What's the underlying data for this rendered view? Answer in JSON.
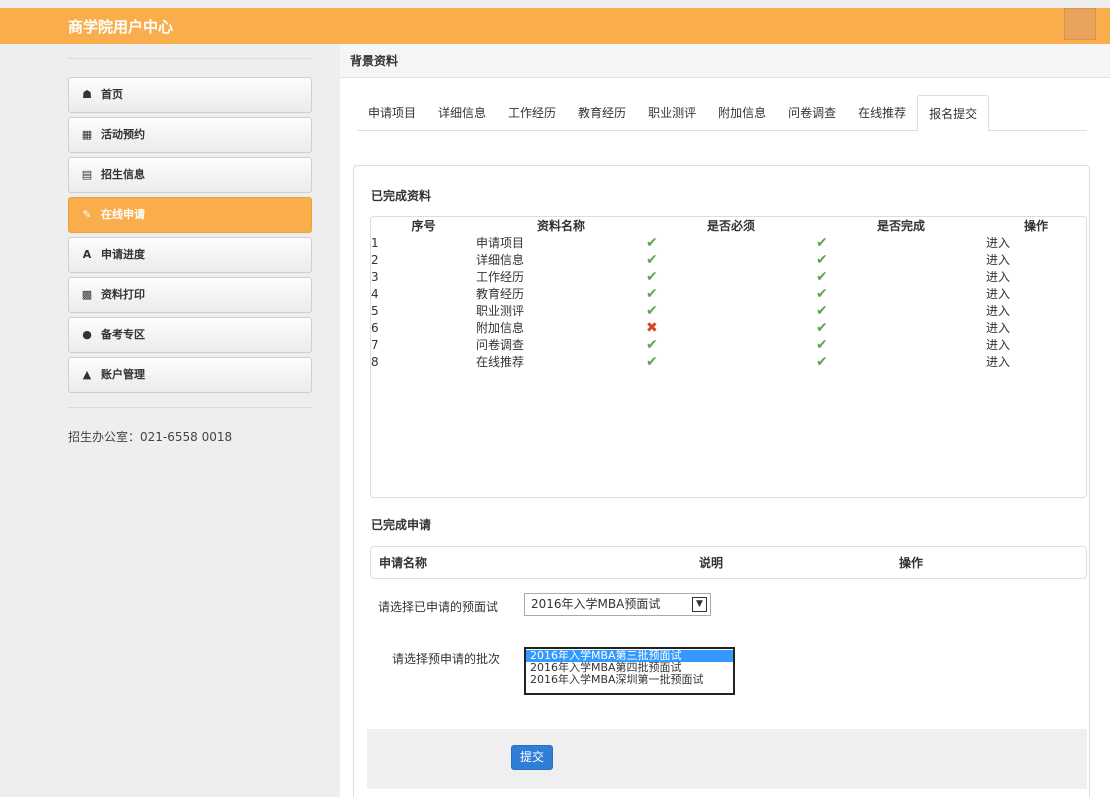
{
  "header": {
    "title": "商学院用户中心"
  },
  "sidebar": {
    "items": [
      {
        "label": "首页",
        "icon": "home-icon"
      },
      {
        "label": "活动预约",
        "icon": "calendar-icon"
      },
      {
        "label": "招生信息",
        "icon": "book-icon"
      },
      {
        "label": "在线申请",
        "icon": "edit-icon",
        "active": true
      },
      {
        "label": "申请进度",
        "icon": "font-icon"
      },
      {
        "label": "资料打印",
        "icon": "print-icon"
      },
      {
        "label": "备考专区",
        "icon": "lock-icon"
      },
      {
        "label": "账户管理",
        "icon": "user-icon"
      }
    ],
    "contact": "招生办公室：021-6558 0018"
  },
  "main": {
    "heading": "背景资料",
    "tabs": [
      "申请项目",
      "详细信息",
      "工作经历",
      "教育经历",
      "职业测评",
      "附加信息",
      "问卷调查",
      "在线推荐",
      "报名提交"
    ],
    "active_tab": "报名提交",
    "completed_section": {
      "title": "已完成资料",
      "columns": [
        "序号",
        "资料名称",
        "是否必须",
        "是否完成",
        "操作"
      ],
      "rows": [
        {
          "no": "1",
          "name": "申请项目",
          "required": true,
          "done": true,
          "action": "进入"
        },
        {
          "no": "2",
          "name": "详细信息",
          "required": true,
          "done": true,
          "action": "进入"
        },
        {
          "no": "3",
          "name": "工作经历",
          "required": true,
          "done": true,
          "action": "进入"
        },
        {
          "no": "4",
          "name": "教育经历",
          "required": true,
          "done": true,
          "action": "进入"
        },
        {
          "no": "5",
          "name": "职业测评",
          "required": true,
          "done": true,
          "action": "进入"
        },
        {
          "no": "6",
          "name": "附加信息",
          "required": false,
          "done": true,
          "action": "进入"
        },
        {
          "no": "7",
          "name": "问卷调查",
          "required": true,
          "done": true,
          "action": "进入"
        },
        {
          "no": "8",
          "name": "在线推荐",
          "required": true,
          "done": true,
          "action": "进入"
        }
      ]
    },
    "applications_section": {
      "title": "已完成申请",
      "columns": [
        "申请名称",
        "说明",
        "操作"
      ]
    },
    "form": {
      "interview_label": "请选择已申请的预面试",
      "interview_value": "2016年入学MBA预面试",
      "batch_label": "请选择预申请的批次",
      "batch_options": [
        "2016年入学MBA第三批预面试",
        "2016年入学MBA第四批预面试",
        "2016年入学MBA深圳第一批预面试"
      ],
      "batch_selected_index": 0,
      "submit_label": "提交"
    }
  }
}
